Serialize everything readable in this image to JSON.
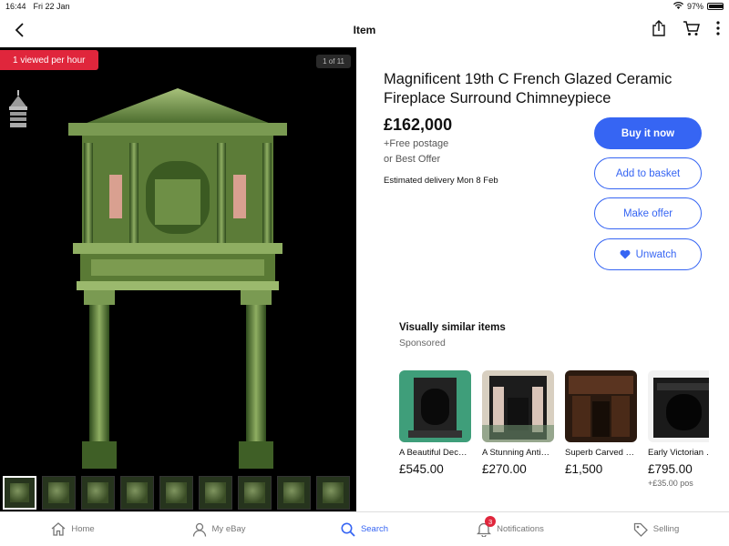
{
  "status": {
    "time": "16:44",
    "date": "Fri 22 Jan",
    "battery": "97%",
    "battery_level": 0.97
  },
  "nav": {
    "title": "Item"
  },
  "gallery": {
    "badge": "1 viewed per hour",
    "counter": "1 of 11",
    "thumbnail_count": 9
  },
  "item": {
    "title": "Magnificent 19th C French Glazed Ceramic Fireplace Surround Chimneypiece",
    "price": "£162,000",
    "postage": "+Free postage",
    "best_offer": "or Best Offer",
    "delivery_label": "Estimated delivery",
    "delivery_date": "Mon 8 Feb"
  },
  "buttons": {
    "buy_now": "Buy it now",
    "add_to_basket": "Add to basket",
    "make_offer": "Make offer",
    "unwatch": "Unwatch"
  },
  "similar": {
    "title": "Visually similar items",
    "sponsored": "Sponsored",
    "items": [
      {
        "name": "A Beautiful Decorative Ori...",
        "price": "£545.00",
        "postage": ""
      },
      {
        "name": "A Stunning Antique High...",
        "price": "£270.00",
        "postage": ""
      },
      {
        "name": "Superb Carved Oak Antique O...",
        "price": "£1,500",
        "postage": ""
      },
      {
        "name": "Early Victorian Cast Iron Fire...",
        "price": "£795.00",
        "postage": "+£35.00 pos"
      }
    ]
  },
  "tabs": [
    {
      "label": "Home",
      "icon": "home-icon"
    },
    {
      "label": "My eBay",
      "icon": "person-icon"
    },
    {
      "label": "Search",
      "icon": "search-icon",
      "active": true
    },
    {
      "label": "Notifications",
      "icon": "bell-icon",
      "badge": "3"
    },
    {
      "label": "Selling",
      "icon": "tag-icon"
    }
  ],
  "colors": {
    "accent": "#3665f3",
    "badge": "#e0263c",
    "glaze": "#5f7d3a"
  }
}
